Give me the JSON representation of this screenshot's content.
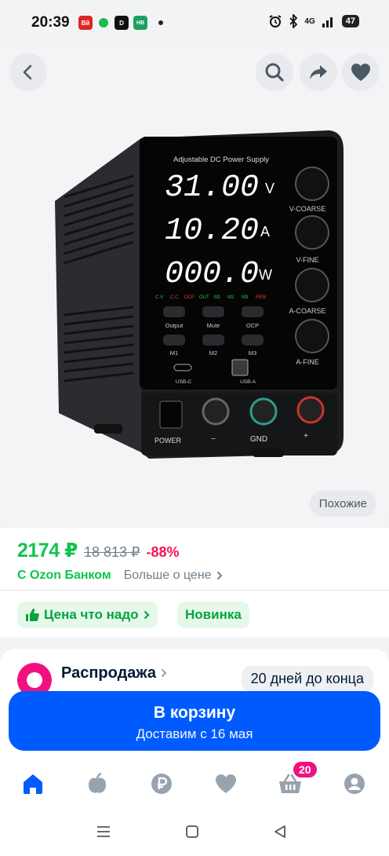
{
  "status_bar": {
    "time": "20:39",
    "apps": [
      {
        "icon": "vk-news-app-icon",
        "label": "Вй",
        "color": "#e02424"
      },
      {
        "icon": "spotify-icon",
        "label": "",
        "color": "#1db954"
      },
      {
        "icon": "d-app-icon",
        "label": "D",
        "color": "#111111"
      },
      {
        "icon": "news-app-icon",
        "label": "НВ",
        "color": "#1aa260"
      }
    ],
    "network": "4G",
    "battery": "47"
  },
  "hero": {
    "product_labels": {
      "panel_title": "Adjustable DC Power Supply",
      "voltage": "31.00",
      "voltage_unit": "V",
      "current": "10.20",
      "current_unit": "A",
      "power": "000.0",
      "power_unit": "W",
      "indicators": [
        "C.V",
        "C.C",
        "OCP",
        "OUT",
        "M1",
        "M2",
        "M3",
        "REM"
      ],
      "buttons_row1": [
        "Output",
        "Mute",
        "OCP"
      ],
      "buttons_row2": [
        "M1",
        "M2",
        "M3"
      ],
      "ports": [
        "USB-C",
        "USB-A"
      ],
      "knobs": [
        "V-COARSE",
        "V-FINE",
        "A-COARSE",
        "A-FINE"
      ],
      "power_label": "POWER",
      "terminals": [
        "−",
        "GND",
        "+"
      ]
    },
    "similar_label": "Похожие"
  },
  "price": {
    "current": "2174 ₽",
    "old": "18 813 ₽",
    "discount": "-88%",
    "bank_label": "С Ozon Банком",
    "more_label": "Больше о цене"
  },
  "badges": [
    {
      "label": "Цена что надо",
      "icon": "thumbs-up-icon"
    },
    {
      "label": "Новинка"
    }
  ],
  "sale": {
    "title": "Распродажа",
    "days_left": "20 дней до конца"
  },
  "cart_button": {
    "title": "В корзину",
    "subtitle": "Доставим с 16 мая"
  },
  "bottom_nav": {
    "items": [
      "home-icon",
      "fresh-icon",
      "ruble-icon",
      "favorites-icon",
      "cart-icon",
      "profile-icon"
    ],
    "cart_count": "20",
    "accent": "#005bff"
  },
  "colors": {
    "accent": "#005bff",
    "price": "#10c44c",
    "discount": "#f91155"
  }
}
